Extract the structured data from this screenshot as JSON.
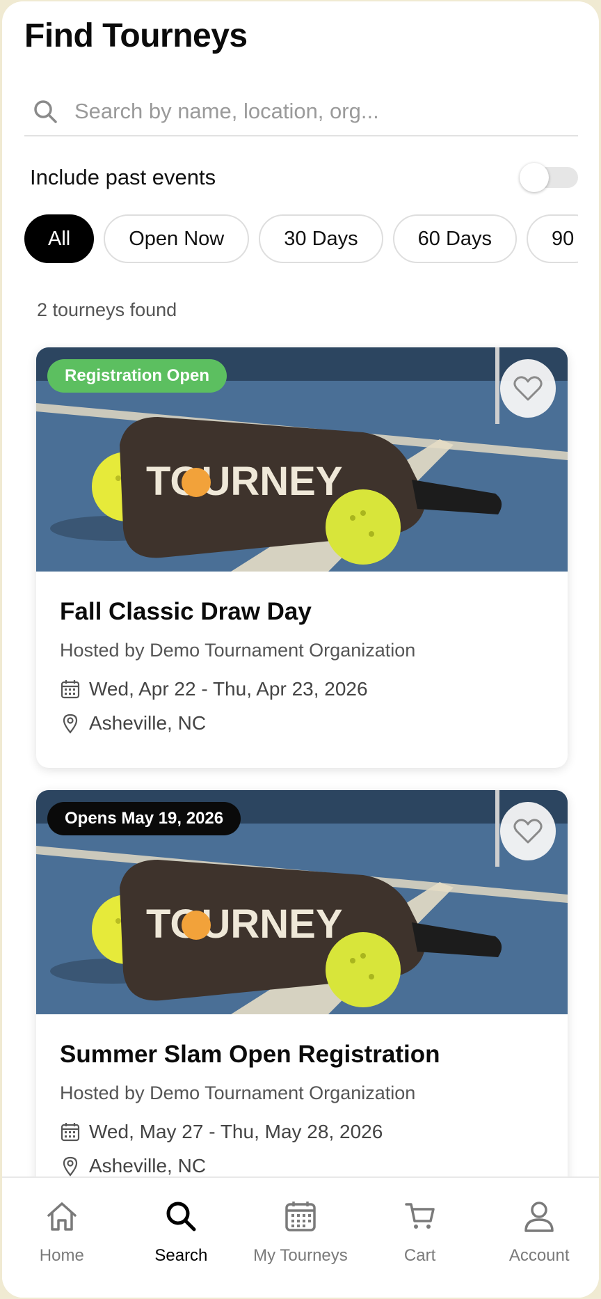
{
  "header": {
    "title": "Find Tourneys"
  },
  "search": {
    "placeholder": "Search by name, location, org..."
  },
  "filters": {
    "past_label": "Include past events",
    "past_enabled": false,
    "chips": [
      "All",
      "Open Now",
      "30 Days",
      "60 Days",
      "90"
    ],
    "active_chip": "All"
  },
  "results": {
    "count_text": "2 tourneys found"
  },
  "cards": [
    {
      "badge": "Registration Open",
      "badge_color": "#5cbf60",
      "image_logo": "TOURNEY",
      "title": "Fall Classic Draw Day",
      "host": "Hosted by Demo Tournament Organization",
      "dates": "Wed, Apr 22 - Thu, Apr 23, 2026",
      "location": "Asheville, NC",
      "favorited": false
    },
    {
      "badge": "Opens May 19, 2026",
      "badge_color": "#0a0a0a",
      "image_logo": "TOURNEY",
      "title": "Summer Slam Open Registration",
      "host": "Hosted by Demo Tournament Organization",
      "dates": "Wed, May 27 - Thu, May 28, 2026",
      "location": "Asheville, NC",
      "favorited": false
    }
  ],
  "tabbar": {
    "items": [
      {
        "label": "Home",
        "icon": "home-icon"
      },
      {
        "label": "Search",
        "icon": "search-icon"
      },
      {
        "label": "My Tourneys",
        "icon": "calendar-icon"
      },
      {
        "label": "Cart",
        "icon": "cart-icon"
      },
      {
        "label": "Account",
        "icon": "user-icon"
      }
    ],
    "active": "Search"
  },
  "colors": {
    "accent": "#000000",
    "open_badge": "#5cbf60",
    "court_blue": "#4a6f96"
  }
}
